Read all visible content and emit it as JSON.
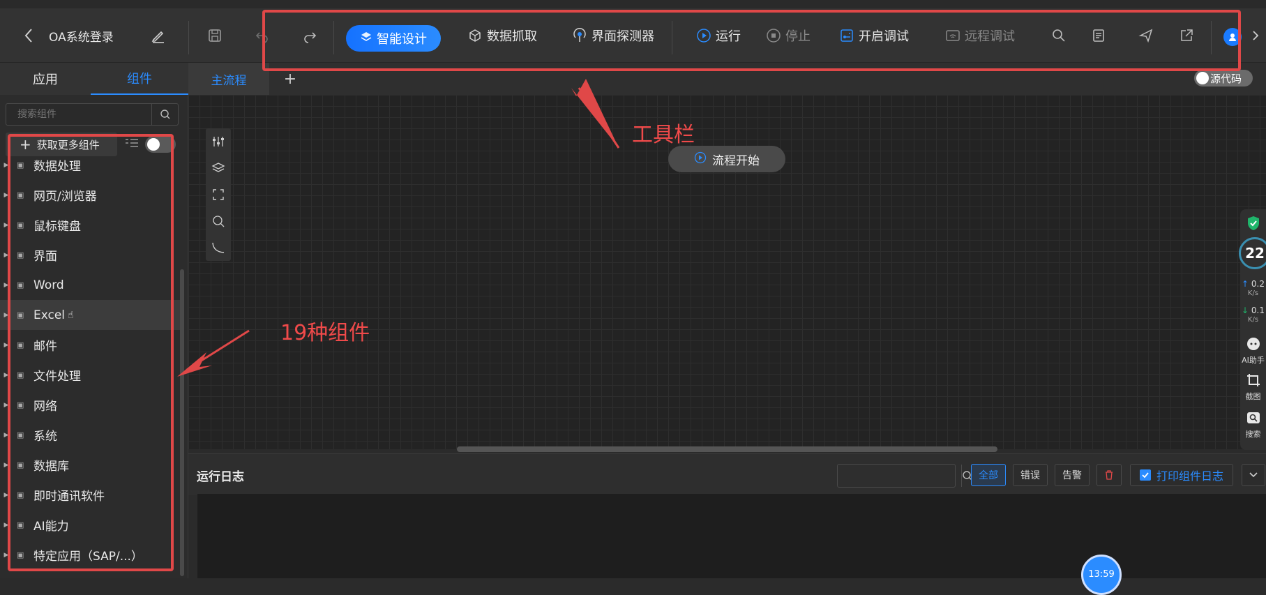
{
  "header": {
    "title": "OA系统登录",
    "buttons": {
      "smart_design": "智能设计",
      "data_capture": "数据抓取",
      "ui_detector": "界面探测器",
      "run": "运行",
      "stop": "停止",
      "start_debug": "开启调试",
      "remote_debug": "远程调试"
    }
  },
  "left_tabs": [
    "应用",
    "组件"
  ],
  "canvas_tabs": {
    "main": "主流程",
    "add": "+"
  },
  "source_toggle": "源代码",
  "search": {
    "placeholder": "搜索组件"
  },
  "get_more": "获取更多组件",
  "components": [
    "数据处理",
    "网页/浏览器",
    "鼠标键盘",
    "界面",
    "Word",
    "Excel",
    "邮件",
    "文件处理",
    "网络",
    "系统",
    "数据库",
    "即时通讯软件",
    "AI能力",
    "特定应用（SAP/...）"
  ],
  "flow_start": "流程开始",
  "annotations": {
    "toolbar": "工具栏",
    "components": "19种组件"
  },
  "log": {
    "title": "运行日志",
    "filters": [
      "全部",
      "错误",
      "告警"
    ],
    "print_label": "打印组件日志"
  },
  "right_panel": {
    "percent": "22",
    "up_speed": "0.2",
    "up_unit": "K/s",
    "down_speed": "0.1",
    "down_unit": "K/s",
    "ai": "AI助手",
    "screenshot": "截图",
    "search": "搜索"
  },
  "clock": "13:59",
  "colors": {
    "accent": "#1a7bff",
    "annotation": "#e04848",
    "background": "#2b2b2b"
  }
}
